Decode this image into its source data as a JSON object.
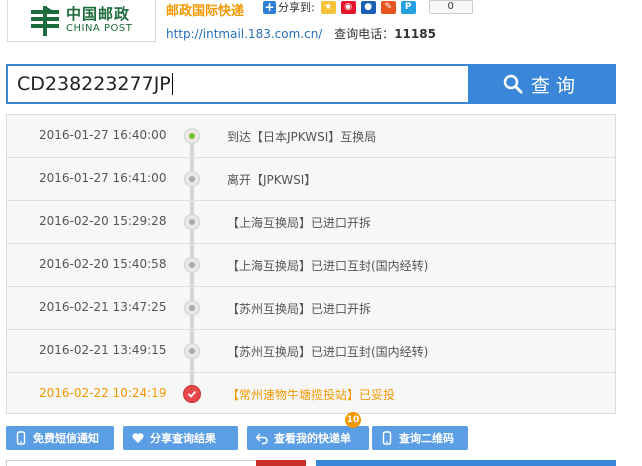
{
  "header": {
    "logo_cn": "中国邮政",
    "logo_en": "CHINA POST",
    "brand_title": "邮政国际快递",
    "share_label": "分享到:",
    "share_count": "0",
    "url": "http://intmail.183.com.cn/",
    "phone_label": "查询电话：",
    "phone_number": "11185"
  },
  "search": {
    "value": "CD238223277JP",
    "button_label": "查询"
  },
  "timeline": [
    {
      "time": "2016-01-27 16:40:00",
      "desc": "到达【日本JPKWSI】互换局"
    },
    {
      "time": "2016-01-27 16:41:00",
      "desc": "离开【JPKWSI】"
    },
    {
      "time": "2016-02-20 15:29:28",
      "desc": "【上海互换局】已进口开拆"
    },
    {
      "time": "2016-02-20 15:40:58",
      "desc": "【上海互换局】已进口互封(国内经转)"
    },
    {
      "time": "2016-02-21 13:47:25",
      "desc": "【苏州互换局】已进口开拆"
    },
    {
      "time": "2016-02-21 13:49:15",
      "desc": "【苏州互换局】已进口互封(国内经转)"
    },
    {
      "time": "2016-02-22 10:24:19",
      "desc": "【常州速物牛塘揽投站】已妥投"
    }
  ],
  "actions": {
    "sms": "免费短信通知",
    "share": "分享查询结果",
    "my": "查看我的快递单",
    "my_badge": "10",
    "qr": "查询二维码"
  },
  "colors": {
    "accent_blue": "#3a86d8",
    "accent_orange": "#f39800",
    "brand_green": "#1e6b3c",
    "delivered_red": "#e8484a"
  }
}
